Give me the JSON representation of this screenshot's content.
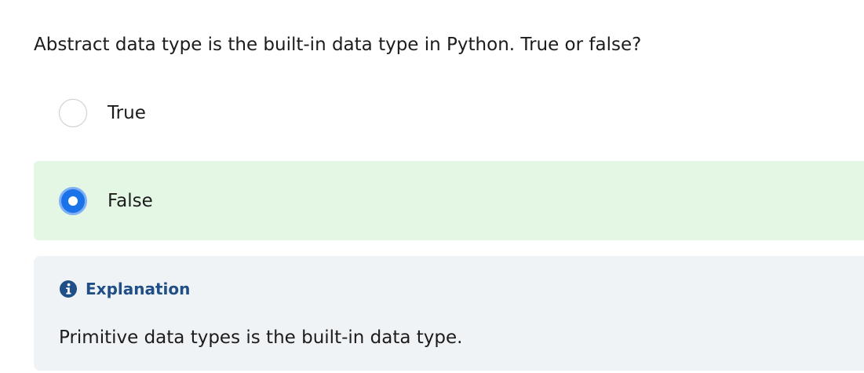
{
  "question": {
    "text": "Abstract data type is the built-in data type in Python. True or false?"
  },
  "options": [
    {
      "label": "True",
      "selected": false
    },
    {
      "label": "False",
      "selected": true
    }
  ],
  "explanation": {
    "icon": "info-icon",
    "title": "Explanation",
    "body": "Primitive data types is the built-in data type."
  },
  "colors": {
    "correct_background": "#e4f7e5",
    "radio_selected": "#1a73e8",
    "explanation_background": "#f0f3f6",
    "explanation_title": "#1f4f86"
  }
}
